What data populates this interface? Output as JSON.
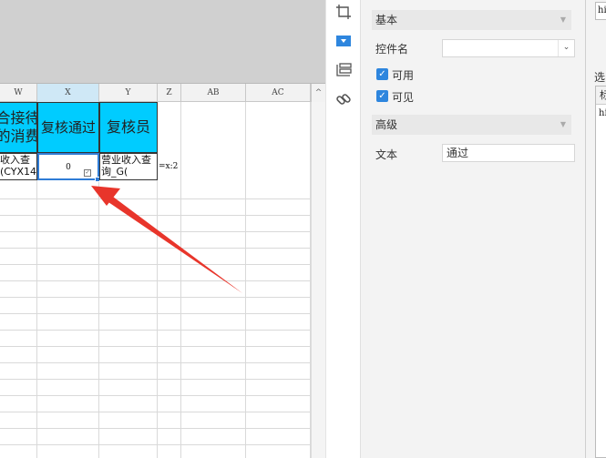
{
  "sheet": {
    "columns": [
      "W",
      "X",
      "Y",
      "Z",
      "AB",
      "AC"
    ],
    "scroll_up": "^",
    "header_cells": {
      "w": "合接待\n的消费",
      "x": "复核通过",
      "y": "复核员"
    },
    "data_cells": {
      "w": "收入查\n(CYX14",
      "x": "0",
      "y": "营业收入查\n询_G(",
      "z": "=x:2"
    }
  },
  "icons": {
    "strip": [
      "crop-frame-icon",
      "dropdown-widget-icon",
      "layers-icon",
      "link-icon"
    ]
  },
  "props": {
    "basic_section": "基本",
    "control_name_label": "控件名",
    "control_name_value": "",
    "enabled_label": "可用",
    "visible_label": "可见",
    "advanced_section": "高级",
    "text_label": "文本",
    "text_value": "通过"
  },
  "right_edge": {
    "top_input": "hi",
    "label": "选",
    "list_head": "标",
    "list_item": "hi"
  }
}
